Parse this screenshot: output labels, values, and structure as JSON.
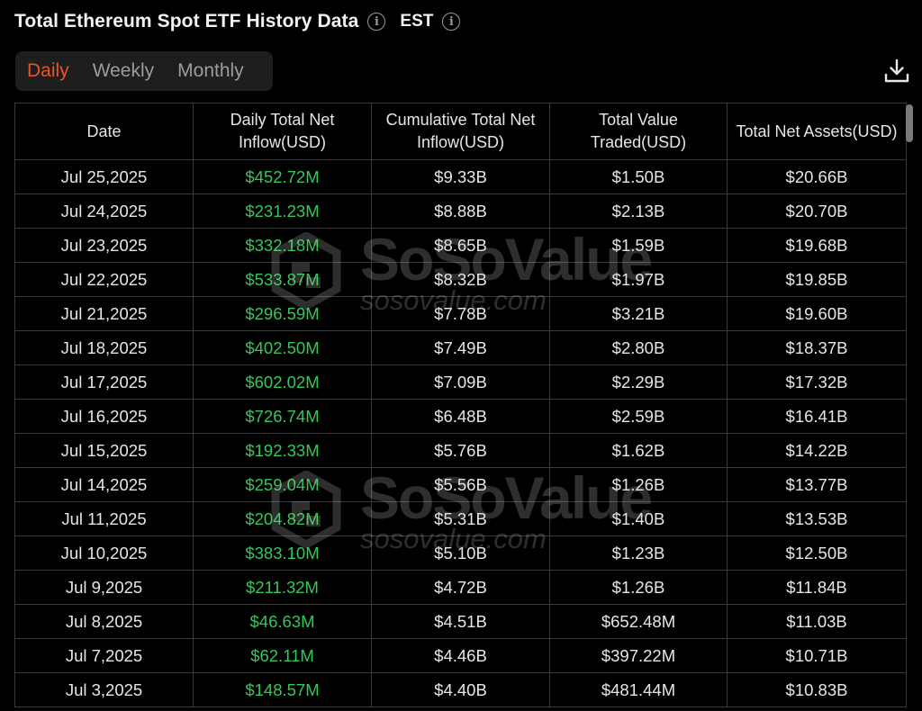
{
  "header": {
    "title": "Total Ethereum Spot ETF History Data",
    "timezone": "EST"
  },
  "tabs": [
    {
      "label": "Daily",
      "active": true
    },
    {
      "label": "Weekly",
      "active": false
    },
    {
      "label": "Monthly",
      "active": false
    }
  ],
  "colors": {
    "accent": "#e8532a",
    "positive": "#34c759",
    "background": "#000000"
  },
  "watermark": {
    "brand": "SoSoValue",
    "url": "sosovalue.com"
  },
  "table": {
    "columns": [
      "Date",
      "Daily Total Net Inflow(USD)",
      "Cumulative Total Net Inflow(USD)",
      "Total Value Traded(USD)",
      "Total Net Assets(USD)"
    ],
    "rows": [
      [
        "Jul 25,2025",
        "$452.72M",
        "$9.33B",
        "$1.50B",
        "$20.66B"
      ],
      [
        "Jul 24,2025",
        "$231.23M",
        "$8.88B",
        "$2.13B",
        "$20.70B"
      ],
      [
        "Jul 23,2025",
        "$332.18M",
        "$8.65B",
        "$1.59B",
        "$19.68B"
      ],
      [
        "Jul 22,2025",
        "$533.87M",
        "$8.32B",
        "$1.97B",
        "$19.85B"
      ],
      [
        "Jul 21,2025",
        "$296.59M",
        "$7.78B",
        "$3.21B",
        "$19.60B"
      ],
      [
        "Jul 18,2025",
        "$402.50M",
        "$7.49B",
        "$2.80B",
        "$18.37B"
      ],
      [
        "Jul 17,2025",
        "$602.02M",
        "$7.09B",
        "$2.29B",
        "$17.32B"
      ],
      [
        "Jul 16,2025",
        "$726.74M",
        "$6.48B",
        "$2.59B",
        "$16.41B"
      ],
      [
        "Jul 15,2025",
        "$192.33M",
        "$5.76B",
        "$1.62B",
        "$14.22B"
      ],
      [
        "Jul 14,2025",
        "$259.04M",
        "$5.56B",
        "$1.26B",
        "$13.77B"
      ],
      [
        "Jul 11,2025",
        "$204.82M",
        "$5.31B",
        "$1.40B",
        "$13.53B"
      ],
      [
        "Jul 10,2025",
        "$383.10M",
        "$5.10B",
        "$1.23B",
        "$12.50B"
      ],
      [
        "Jul 9,2025",
        "$211.32M",
        "$4.72B",
        "$1.26B",
        "$11.84B"
      ],
      [
        "Jul 8,2025",
        "$46.63M",
        "$4.51B",
        "$652.48M",
        "$11.03B"
      ],
      [
        "Jul 7,2025",
        "$62.11M",
        "$4.46B",
        "$397.22M",
        "$10.71B"
      ],
      [
        "Jul 3,2025",
        "$148.57M",
        "$4.40B",
        "$481.44M",
        "$10.83B"
      ]
    ]
  }
}
